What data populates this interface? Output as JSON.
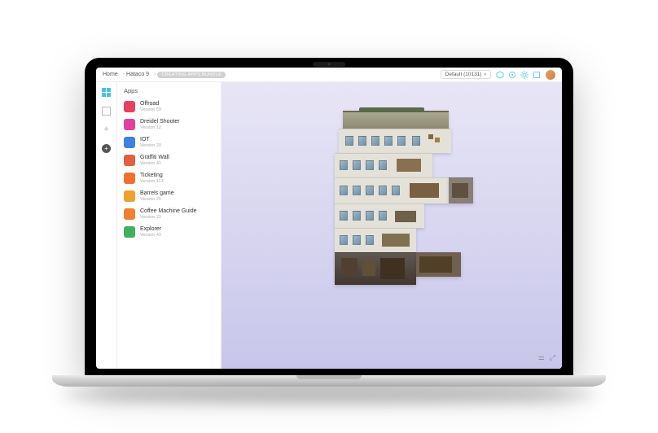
{
  "breadcrumb": {
    "home": "Home",
    "project": "Hataco 9"
  },
  "badge": "CREATING APPS BUNDLE",
  "dropdown": {
    "label": "Default (10131)"
  },
  "panel_title": "Apps",
  "apps": [
    {
      "name": "Offroad",
      "version": "Version 59",
      "color": "#e84060"
    },
    {
      "name": "Dreidel Shooter",
      "version": "Version 12",
      "color": "#e040a0"
    },
    {
      "name": "IOT",
      "version": "Version 29",
      "color": "#4080e0"
    },
    {
      "name": "Graffiti Wall",
      "version": "Version 41",
      "color": "#e06040"
    },
    {
      "name": "Ticketing",
      "version": "Version 113",
      "color": "#f07030"
    },
    {
      "name": "Barrels game",
      "version": "Version 25",
      "color": "#f0a030"
    },
    {
      "name": "Coffee Machine Guide",
      "version": "Version 22",
      "color": "#f08030"
    },
    {
      "name": "Explorer",
      "version": "Version 42",
      "color": "#40b060"
    }
  ]
}
